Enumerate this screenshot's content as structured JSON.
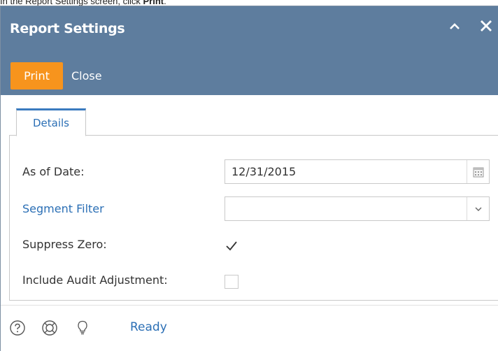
{
  "caption": {
    "prefix": "In the Report Settings screen, click ",
    "bold": "Print",
    "suffix": "."
  },
  "window": {
    "title": "Report Settings",
    "collapse_icon": "chevron-up-icon",
    "close_icon": "close-icon"
  },
  "toolbar": {
    "print_label": "Print",
    "close_label": "Close",
    "print_color": "#f7941d"
  },
  "tabs": [
    {
      "label": "Details",
      "active": true
    }
  ],
  "form": {
    "as_of_date": {
      "label": "As of Date:",
      "value": "12/31/2015",
      "icon": "calendar-icon"
    },
    "segment_filter": {
      "label": "Segment Filter",
      "value": "",
      "icon": "chevron-down-icon"
    },
    "suppress_zero": {
      "label": "Suppress Zero:",
      "checked": true
    },
    "include_audit_adjustment": {
      "label": "Include Audit Adjustment:",
      "checked": false
    }
  },
  "statusbar": {
    "icons": [
      "help-icon",
      "support-icon",
      "lightbulb-icon"
    ],
    "status": "Ready"
  },
  "colors": {
    "header": "#5e7d9e",
    "accent": "#2b6fb5"
  }
}
